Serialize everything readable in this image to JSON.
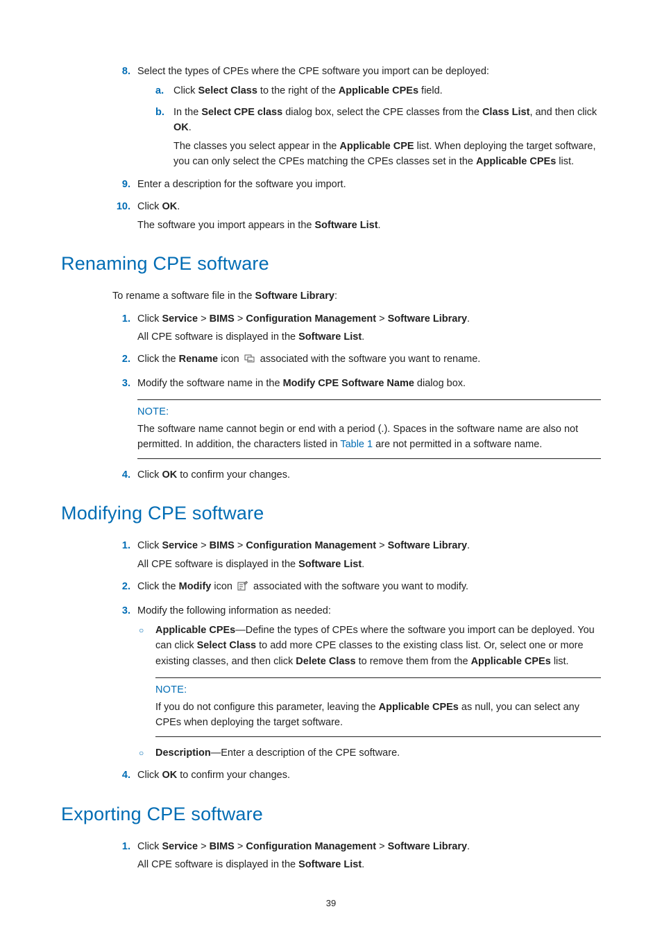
{
  "intro": {
    "steps": [
      {
        "n": "8.",
        "text": "Select the types of CPEs where the CPE software you import can be deployed:",
        "sub": [
          {
            "m": "a.",
            "segments": [
              {
                "t": "Click "
              },
              {
                "t": "Select Class",
                "b": true
              },
              {
                "t": " to the right of the "
              },
              {
                "t": "Applicable CPEs",
                "b": true
              },
              {
                "t": " field."
              }
            ]
          },
          {
            "m": "b.",
            "segments": [
              {
                "t": "In the "
              },
              {
                "t": "Select CPE class",
                "b": true
              },
              {
                "t": " dialog box, select the CPE classes from the "
              },
              {
                "t": "Class List",
                "b": true
              },
              {
                "t": ", and then click "
              },
              {
                "t": "OK",
                "b": true
              },
              {
                "t": "."
              }
            ],
            "after": [
              {
                "t": "The classes you select appear in the "
              },
              {
                "t": "Applicable CPE",
                "b": true
              },
              {
                "t": " list. When deploying the target software, you can only select the CPEs matching the CPEs classes set in the "
              },
              {
                "t": "Applicable CPEs",
                "b": true
              },
              {
                "t": " list."
              }
            ]
          }
        ]
      },
      {
        "n": "9.",
        "text": "Enter a description for the software you import."
      },
      {
        "n": "10.",
        "segments": [
          {
            "t": "Click "
          },
          {
            "t": "OK",
            "b": true
          },
          {
            "t": "."
          }
        ],
        "after": [
          {
            "t": "The software you import appears in the "
          },
          {
            "t": "Software List",
            "b": true
          },
          {
            "t": "."
          }
        ]
      }
    ]
  },
  "rename": {
    "heading": "Renaming CPE software",
    "lead": [
      {
        "t": "To rename a software file in the "
      },
      {
        "t": "Software Library",
        "b": true
      },
      {
        "t": ":"
      }
    ],
    "steps": [
      {
        "n": "1.",
        "segments": [
          {
            "t": "Click "
          },
          {
            "t": "Service",
            "b": true
          },
          {
            "t": " > "
          },
          {
            "t": "BIMS",
            "b": true
          },
          {
            "t": " > "
          },
          {
            "t": "Configuration Management",
            "b": true
          },
          {
            "t": " > "
          },
          {
            "t": "Software Library",
            "b": true
          },
          {
            "t": "."
          }
        ],
        "after": [
          {
            "t": "All CPE software is displayed in the "
          },
          {
            "t": "Software List",
            "b": true
          },
          {
            "t": "."
          }
        ]
      },
      {
        "n": "2.",
        "segments": [
          {
            "t": "Click the "
          },
          {
            "t": "Rename",
            "b": true
          },
          {
            "t": " icon "
          },
          {
            "icon": "rename-icon"
          },
          {
            "t": " associated with the software you want to rename."
          }
        ]
      },
      {
        "n": "3.",
        "segments": [
          {
            "t": "Modify the software name in the "
          },
          {
            "t": "Modify CPE Software Name",
            "b": true
          },
          {
            "t": " dialog box."
          }
        ],
        "note": {
          "label": "NOTE:",
          "body": [
            {
              "t": "The software name cannot begin or end with a period (.). Spaces in the software name are also not permitted. In addition, the characters listed in "
            },
            {
              "t": "Table 1",
              "link": true
            },
            {
              "t": " are not permitted in a software name."
            }
          ]
        }
      },
      {
        "n": "4.",
        "segments": [
          {
            "t": "Click "
          },
          {
            "t": "OK",
            "b": true
          },
          {
            "t": " to confirm your changes."
          }
        ]
      }
    ]
  },
  "modify": {
    "heading": "Modifying CPE software",
    "steps": [
      {
        "n": "1.",
        "segments": [
          {
            "t": "Click "
          },
          {
            "t": "Service",
            "b": true
          },
          {
            "t": " > "
          },
          {
            "t": "BIMS",
            "b": true
          },
          {
            "t": " > "
          },
          {
            "t": "Configuration Management",
            "b": true
          },
          {
            "t": " > "
          },
          {
            "t": "Software Library",
            "b": true
          },
          {
            "t": "."
          }
        ],
        "after": [
          {
            "t": "All CPE software is displayed in the "
          },
          {
            "t": "Software List",
            "b": true
          },
          {
            "t": "."
          }
        ]
      },
      {
        "n": "2.",
        "segments": [
          {
            "t": "Click the "
          },
          {
            "t": "Modify",
            "b": true
          },
          {
            "t": " icon "
          },
          {
            "icon": "modify-icon"
          },
          {
            "t": " associated with the software you want to modify."
          }
        ]
      },
      {
        "n": "3.",
        "text": "Modify the following information as needed:",
        "bullets": [
          {
            "segments": [
              {
                "t": "Applicable CPEs",
                "b": true
              },
              {
                "t": "—Define the types of CPEs where the software you import can be deployed. You can click "
              },
              {
                "t": "Select Class",
                "b": true
              },
              {
                "t": " to add more CPE classes to the existing class list. Or, select one or more existing classes, and then click "
              },
              {
                "t": "Delete Class",
                "b": true
              },
              {
                "t": " to remove them from the "
              },
              {
                "t": "Applicable CPEs",
                "b": true
              },
              {
                "t": " list."
              }
            ],
            "note": {
              "label": "NOTE:",
              "body": [
                {
                  "t": "If you do not configure this parameter, leaving the "
                },
                {
                  "t": "Applicable CPEs",
                  "b": true
                },
                {
                  "t": " as null, you can select any CPEs when deploying the target software."
                }
              ]
            }
          },
          {
            "segments": [
              {
                "t": "Description",
                "b": true
              },
              {
                "t": "—Enter a description of the CPE software."
              }
            ]
          }
        ]
      },
      {
        "n": "4.",
        "segments": [
          {
            "t": "Click "
          },
          {
            "t": "OK",
            "b": true
          },
          {
            "t": " to confirm your changes."
          }
        ]
      }
    ]
  },
  "export": {
    "heading": "Exporting CPE software",
    "steps": [
      {
        "n": "1.",
        "segments": [
          {
            "t": "Click "
          },
          {
            "t": "Service",
            "b": true
          },
          {
            "t": " > "
          },
          {
            "t": "BIMS",
            "b": true
          },
          {
            "t": " > "
          },
          {
            "t": "Configuration Management",
            "b": true
          },
          {
            "t": " > "
          },
          {
            "t": "Software Library",
            "b": true
          },
          {
            "t": "."
          }
        ],
        "after": [
          {
            "t": "All CPE software is displayed in the "
          },
          {
            "t": "Software List",
            "b": true
          },
          {
            "t": "."
          }
        ]
      }
    ]
  },
  "page_number": "39"
}
